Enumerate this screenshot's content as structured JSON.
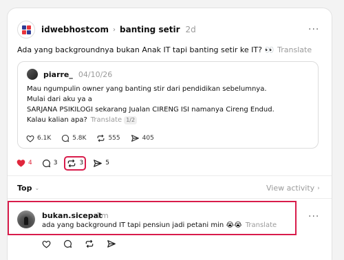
{
  "post": {
    "author": "idwebhostcom",
    "community": "banting setir",
    "time": "2d",
    "text": "Ada yang backgroundnya bukan Anak IT tapi banting setir ke IT? 👀",
    "translate": "Translate"
  },
  "quote": {
    "author": "piarre_",
    "time": "04/10/26",
    "lines": [
      "Mau ngumpulin owner yang banting stir dari pendidikan sebelumnya.",
      "Mulai dari aku ya a",
      "SARJANA PSIKILOGI sekarang Jualan CIRENG ISI namanya Cireng Endud.",
      "Kalau kalian apa?"
    ],
    "translate": "Translate",
    "translate_badge": "1/2",
    "likes": "6.1K",
    "comments": "5.8K",
    "reposts": "555",
    "shares": "405"
  },
  "actions": {
    "likes": "4",
    "comments": "3",
    "reposts": "3",
    "shares": "5"
  },
  "sort": {
    "label": "Top",
    "view_activity": "View activity"
  },
  "reply": {
    "author": "bukan.sicepat",
    "time": "1m",
    "text": "ada yang background IT tapi pensiun jadi petani min 😭😭",
    "translate": "Translate"
  },
  "colors": {
    "like_red": "#e0273c",
    "highlight": "#d81b4a",
    "logo_red": "#e8333a",
    "logo_blue": "#2f3c96"
  }
}
